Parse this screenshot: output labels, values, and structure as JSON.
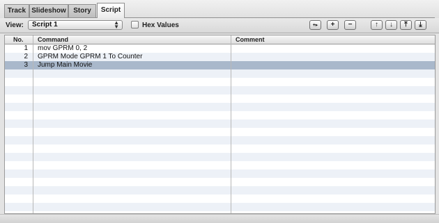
{
  "tabs": [
    {
      "label": "Track",
      "active": false
    },
    {
      "label": "Slideshow",
      "active": false
    },
    {
      "label": "Story",
      "active": false
    },
    {
      "label": "Script",
      "active": true
    }
  ],
  "toolbar": {
    "view_label": "View:",
    "view_select": "Script 1",
    "hex_values_label": "Hex Values",
    "hex_values_checked": false,
    "buttons": [
      {
        "name": "insert-command-button",
        "icon": "insert-icon"
      },
      {
        "name": "add-command-button",
        "icon": "plus-icon"
      },
      {
        "name": "remove-command-button",
        "icon": "minus-icon"
      },
      {
        "name": "move-up-button",
        "icon": "arrow-up-icon"
      },
      {
        "name": "move-down-button",
        "icon": "arrow-down-icon"
      },
      {
        "name": "move-to-top-button",
        "icon": "move-top-icon"
      },
      {
        "name": "move-to-bottom-button",
        "icon": "move-bottom-icon"
      }
    ]
  },
  "table": {
    "headers": {
      "no": "No.",
      "command": "Command",
      "comment": "Comment"
    },
    "rows": [
      {
        "no": "1",
        "command": "mov GPRM 0, 2",
        "comment": ""
      },
      {
        "no": "2",
        "command": "GPRM Mode GPRM 1 To Counter",
        "comment": ""
      },
      {
        "no": "3",
        "command": "Jump Main Movie",
        "comment": "",
        "selected": true
      }
    ]
  },
  "colors": {
    "selected_row": "#a9b8cb",
    "alt_row": "#edf1f7"
  }
}
